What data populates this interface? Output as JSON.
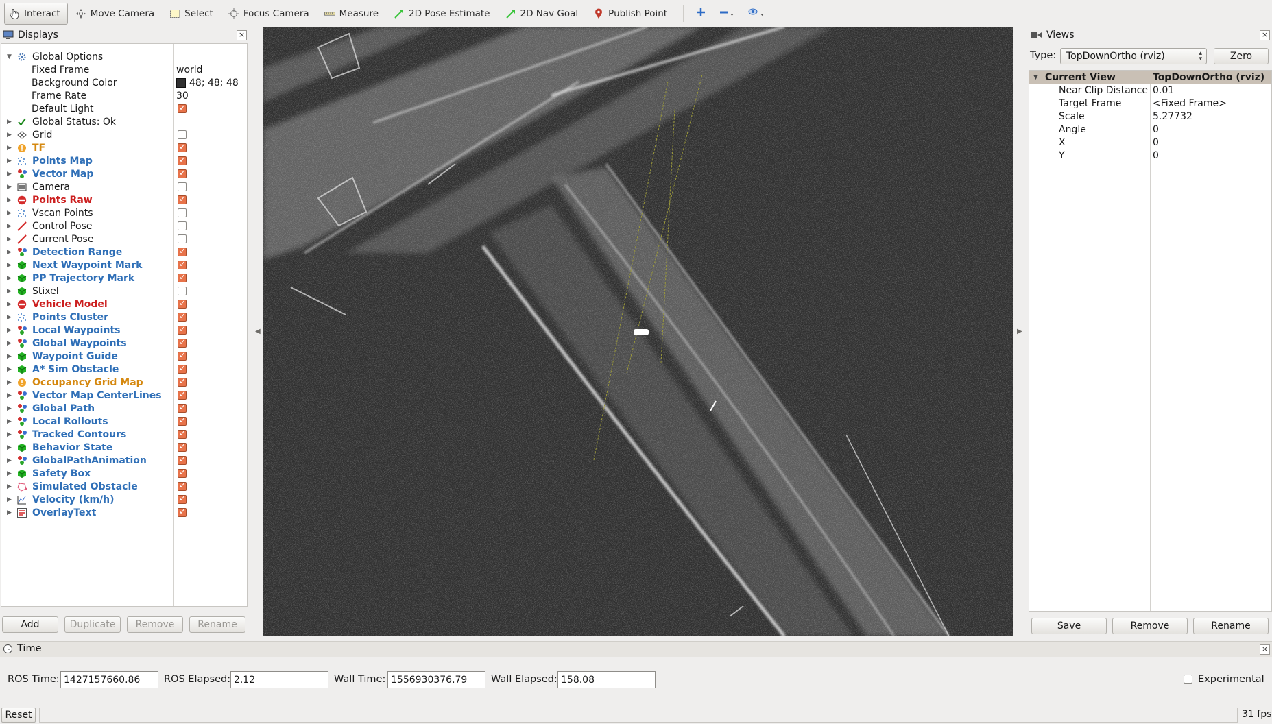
{
  "toolbar": {
    "items": [
      {
        "label": "Interact",
        "icon": "hand-pointer-icon"
      },
      {
        "label": "Move Camera",
        "icon": "move-camera-icon"
      },
      {
        "label": "Select",
        "icon": "select-rect-icon"
      },
      {
        "label": "Focus Camera",
        "icon": "focus-crosshair-icon"
      },
      {
        "label": "Measure",
        "icon": "ruler-icon"
      },
      {
        "label": "2D Pose Estimate",
        "icon": "green-arrow-icon"
      },
      {
        "label": "2D Nav Goal",
        "icon": "green-arrow-icon"
      },
      {
        "label": "Publish Point",
        "icon": "map-pin-icon"
      }
    ]
  },
  "displays": {
    "title": "Displays",
    "global_options": {
      "label": "Global Options",
      "properties": [
        {
          "key": "Fixed Frame",
          "value": "world"
        },
        {
          "key": "Background Color",
          "value": "48; 48; 48"
        },
        {
          "key": "Frame Rate",
          "value": "30"
        },
        {
          "key": "Default Light",
          "value": ""
        }
      ]
    },
    "items": [
      {
        "label": "Global Status: Ok",
        "color": "#1a1a1a",
        "icon": "check-icon",
        "checkbox": null
      },
      {
        "label": "Grid",
        "color": "#1a1a1a",
        "icon": "grid-icon",
        "checkbox": false
      },
      {
        "label": "TF",
        "color": "#d5880f",
        "icon": "warning-icon",
        "checkbox": true
      },
      {
        "label": "Points Map",
        "color": "#2f6fb7",
        "icon": "point-cloud-icon",
        "checkbox": true
      },
      {
        "label": "Vector Map",
        "color": "#2f6fb7",
        "icon": "marker-array-icon",
        "checkbox": true
      },
      {
        "label": "Camera",
        "color": "#1a1a1a",
        "icon": "camera-icon",
        "checkbox": false
      },
      {
        "label": "Points Raw",
        "color": "#cc1f1f",
        "icon": "error-icon",
        "checkbox": true
      },
      {
        "label": "Vscan Points",
        "color": "#1a1a1a",
        "icon": "point-cloud-icon",
        "checkbox": false
      },
      {
        "label": "Control Pose",
        "color": "#1a1a1a",
        "icon": "pose-arrow-icon",
        "checkbox": false
      },
      {
        "label": "Current Pose",
        "color": "#1a1a1a",
        "icon": "pose-arrow-icon",
        "checkbox": false
      },
      {
        "label": "Detection Range",
        "color": "#2f6fb7",
        "icon": "marker-array-icon",
        "checkbox": true
      },
      {
        "label": "Next Waypoint Mark",
        "color": "#2f6fb7",
        "icon": "marker-cube-icon",
        "checkbox": true
      },
      {
        "label": "PP Trajectory Mark",
        "color": "#2f6fb7",
        "icon": "marker-cube-icon",
        "checkbox": true
      },
      {
        "label": "Stixel",
        "color": "#1a1a1a",
        "icon": "marker-cube-icon",
        "checkbox": false
      },
      {
        "label": "Vehicle Model",
        "color": "#cc1f1f",
        "icon": "error-icon",
        "checkbox": true
      },
      {
        "label": "Points Cluster",
        "color": "#2f6fb7",
        "icon": "point-cloud-icon",
        "checkbox": true
      },
      {
        "label": "Local Waypoints",
        "color": "#2f6fb7",
        "icon": "marker-array-icon",
        "checkbox": true
      },
      {
        "label": "Global Waypoints",
        "color": "#2f6fb7",
        "icon": "marker-array-icon",
        "checkbox": true
      },
      {
        "label": "Waypoint Guide",
        "color": "#2f6fb7",
        "icon": "marker-cube-icon",
        "checkbox": true
      },
      {
        "label": "A* Sim Obstacle",
        "color": "#2f6fb7",
        "icon": "marker-cube-icon",
        "checkbox": true
      },
      {
        "label": "Occupancy Grid Map",
        "color": "#d5880f",
        "icon": "warning-icon",
        "checkbox": true
      },
      {
        "label": "Vector Map CenterLines",
        "color": "#2f6fb7",
        "icon": "marker-array-icon",
        "checkbox": true
      },
      {
        "label": "Global Path",
        "color": "#2f6fb7",
        "icon": "marker-array-icon",
        "checkbox": true
      },
      {
        "label": "Local Rollouts",
        "color": "#2f6fb7",
        "icon": "marker-array-icon",
        "checkbox": true
      },
      {
        "label": "Tracked Contours",
        "color": "#2f6fb7",
        "icon": "marker-array-icon",
        "checkbox": true
      },
      {
        "label": "Behavior State",
        "color": "#2f6fb7",
        "icon": "marker-cube-icon",
        "checkbox": true
      },
      {
        "label": "GlobalPathAnimation",
        "color": "#2f6fb7",
        "icon": "marker-array-icon",
        "checkbox": true
      },
      {
        "label": "Safety Box",
        "color": "#2f6fb7",
        "icon": "marker-cube-icon",
        "checkbox": true
      },
      {
        "label": "Simulated Obstacle",
        "color": "#2f6fb7",
        "icon": "polygon-icon",
        "checkbox": true
      },
      {
        "label": "Velocity (km/h)",
        "color": "#2f6fb7",
        "icon": "plot-icon",
        "checkbox": true
      },
      {
        "label": "OverlayText",
        "color": "#2f6fb7",
        "icon": "overlay-text-icon",
        "checkbox": true
      }
    ],
    "buttons": {
      "add": "Add",
      "duplicate": "Duplicate",
      "remove": "Remove",
      "rename": "Rename"
    }
  },
  "views": {
    "title": "Views",
    "type_label": "Type:",
    "type_value": "TopDownOrtho (rviz)",
    "zero_label": "Zero",
    "current_view": {
      "label": "Current View",
      "value": "TopDownOrtho (rviz)"
    },
    "properties": [
      {
        "key": "Near Clip Distance",
        "value": "0.01"
      },
      {
        "key": "Target Frame",
        "value": "<Fixed Frame>"
      },
      {
        "key": "Scale",
        "value": "5.27732"
      },
      {
        "key": "Angle",
        "value": "0"
      },
      {
        "key": "X",
        "value": "0"
      },
      {
        "key": "Y",
        "value": "0"
      }
    ],
    "buttons": {
      "save": "Save",
      "remove": "Remove",
      "rename": "Rename"
    }
  },
  "time": {
    "title": "Time",
    "ros_time_label": "ROS Time:",
    "ros_time": "1427157660.86",
    "ros_elapsed_label": "ROS Elapsed:",
    "ros_elapsed": "2.12",
    "wall_time_label": "Wall Time:",
    "wall_time": "1556930376.79",
    "wall_elapsed_label": "Wall Elapsed:",
    "wall_elapsed": "158.08",
    "experimental_label": "Experimental"
  },
  "status": {
    "reset_label": "Reset",
    "fps": "31 fps"
  },
  "colors": {
    "viewport_bg": "#303030",
    "checkbox_on": "#e8734a",
    "blue_label": "#2f6fb7",
    "red_label": "#cc1f1f",
    "orange_label": "#d5880f"
  }
}
